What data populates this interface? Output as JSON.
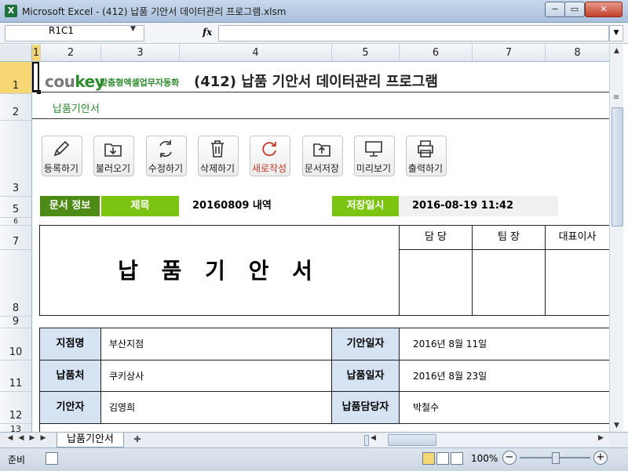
{
  "window": {
    "title": "Microsoft Excel - (412) 납품 기안서 데이터관리 프로그램.xlsm",
    "app_icon": "X",
    "minimize": "−",
    "maximize": "▭",
    "close": "✕"
  },
  "formula_bar": {
    "name_box": "R1C1",
    "fx": "fx",
    "formula": ""
  },
  "columns": [
    "1",
    "2",
    "3",
    "4",
    "5",
    "6",
    "7",
    "8"
  ],
  "rows": [
    "1",
    "2",
    "3",
    "5",
    "6",
    "7",
    "8",
    "9",
    "10",
    "11",
    "12",
    "13"
  ],
  "header": {
    "logo": "coukey",
    "logo_sub": "맞춤형엑셀업무자동화",
    "title": "(412) 납품 기안서 데이터관리 프로그램",
    "subtitle": "납품기안서"
  },
  "toolbar": [
    {
      "label": "등록하기",
      "icon": "pencil-icon"
    },
    {
      "label": "불러오기",
      "icon": "folder-download-icon"
    },
    {
      "label": "수정하기",
      "icon": "refresh-icon"
    },
    {
      "label": "삭제하기",
      "icon": "trash-icon"
    },
    {
      "label": "새로작성",
      "icon": "reload-icon"
    },
    {
      "label": "문서저장",
      "icon": "folder-upload-icon"
    },
    {
      "label": "미리보기",
      "icon": "monitor-icon"
    },
    {
      "label": "출력하기",
      "icon": "printer-icon"
    }
  ],
  "doc_info": {
    "section_label": "문서 정보",
    "subject_label": "제목",
    "subject_value": "20160809 내역",
    "saved_label": "저장일시",
    "saved_value": "2016-08-19 11:42"
  },
  "approval": {
    "doc_title": "납 품 기 안 서",
    "headers": [
      "담 당",
      "팀 장",
      "대표이사"
    ]
  },
  "details": {
    "branch_label": "지점명",
    "branch_value": "부산지점",
    "draft_date_label": "기안일자",
    "draft_date_value": "2016년 8월 11일",
    "vendor_label": "납품처",
    "vendor_value": "쿠키상사",
    "delivery_date_label": "납품일자",
    "delivery_date_value": "2016년 8월 23일",
    "drafter_label": "기안자",
    "drafter_value": "김영희",
    "delivery_person_label": "납품담당자",
    "delivery_person_value": "박철수"
  },
  "sheet_tabs": [
    "납품기안서"
  ],
  "status": {
    "ready": "준비",
    "zoom": "100%"
  },
  "colors": {
    "dark_green": "#4e8a16",
    "light_green": "#7bc411",
    "label_blue": "#d5e3f3",
    "accent_red": "#c0392b"
  }
}
